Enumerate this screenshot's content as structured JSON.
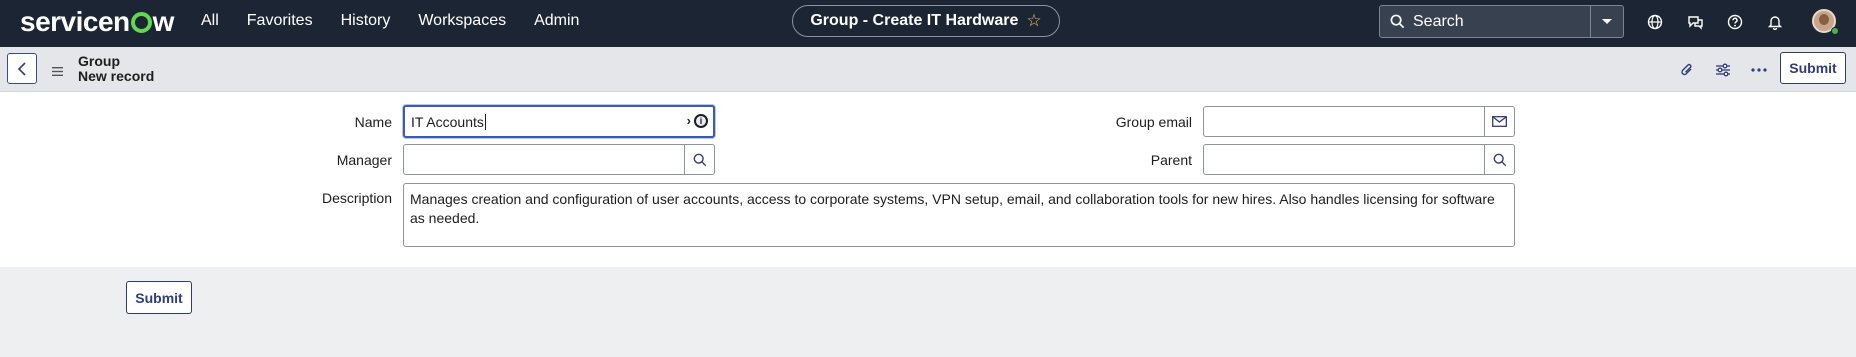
{
  "topnav": {
    "logo": "servicenow",
    "menu": [
      "All",
      "Favorites",
      "History",
      "Workspaces",
      "Admin"
    ],
    "title": "Group - Create IT Hardware",
    "search_placeholder": "Search",
    "icons": [
      "globe-icon",
      "chat-icon",
      "help-icon",
      "bell-icon",
      "avatar"
    ]
  },
  "record": {
    "table": "Group",
    "subtitle": "New record",
    "submit_label": "Submit"
  },
  "form": {
    "name_label": "Name",
    "name_value": "IT Accounts",
    "manager_label": "Manager",
    "manager_value": "",
    "description_label": "Description",
    "description_value": "Manages creation and configuration of user accounts, access to corporate systems, VPN setup, email, and collaboration tools for new hires. Also handles licensing for software as needed.",
    "group_email_label": "Group email",
    "group_email_value": "",
    "parent_label": "Parent",
    "parent_value": ""
  },
  "footer": {
    "submit_label": "Submit"
  },
  "colors": {
    "nav_bg": "#1c2533",
    "accent": "#2f3c7e",
    "brand_green": "#62d84e"
  }
}
